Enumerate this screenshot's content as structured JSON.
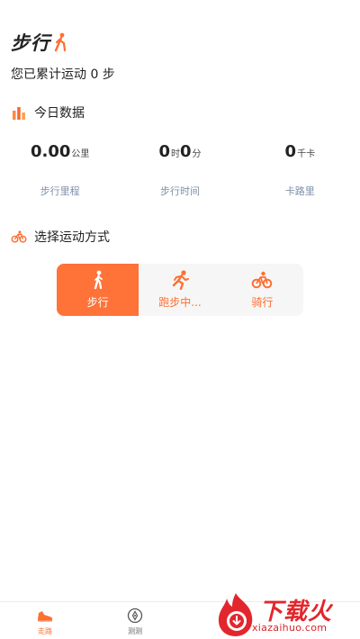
{
  "header": {
    "title": "步行",
    "title_icon": "walking-person-icon",
    "total_text": "您已累计运动 0 步"
  },
  "today": {
    "section_title": "今日数据",
    "section_icon": "bar-chart-icon",
    "stats": [
      {
        "value": "0.00",
        "unit": "公里",
        "label": "步行里程"
      },
      {
        "value_h": "0",
        "unit_h": "时",
        "value_m": "0",
        "unit_m": "分",
        "label": "步行时间"
      },
      {
        "value": "0",
        "unit": "千卡",
        "label": "卡路里"
      }
    ]
  },
  "modes": {
    "section_title": "选择运动方式",
    "section_icon": "bicycle-icon",
    "items": [
      {
        "label": "步行",
        "icon": "walking-icon",
        "active": true
      },
      {
        "label": "跑步中...",
        "icon": "running-icon",
        "active": false
      },
      {
        "label": "骑行",
        "icon": "cycling-icon",
        "active": false
      }
    ]
  },
  "tabbar": {
    "items": [
      {
        "label": "走路",
        "icon": "shoe-icon",
        "active": true
      },
      {
        "label": "测测",
        "icon": "compass-icon",
        "active": false
      }
    ]
  },
  "watermark": {
    "text": "下载火",
    "url": "xiazaihuo.com"
  },
  "colors": {
    "accent": "#ff7238",
    "label_blue_gray": "#7d8fa8",
    "watermark_red": "#e3262d"
  }
}
